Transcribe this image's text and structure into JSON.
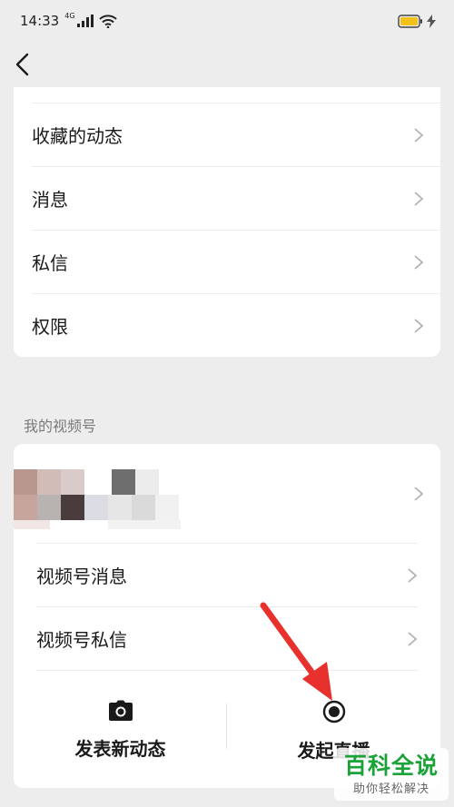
{
  "status_bar": {
    "time": "14:33",
    "network": "4G",
    "battery_color": "#f2c21b",
    "charging_color": "#555555"
  },
  "nav": {
    "back_icon": "chevron-left-icon"
  },
  "top_card": {
    "items": [
      {
        "label": "收藏的动态"
      },
      {
        "label": "消息"
      },
      {
        "label": "私信"
      },
      {
        "label": "权限"
      }
    ]
  },
  "video_section": {
    "header": "我的视频号",
    "items": [
      {
        "label": "视频号消息"
      },
      {
        "label": "视频号私信"
      }
    ],
    "actions": [
      {
        "label": "发表新动态",
        "icon": "camera-icon"
      },
      {
        "label": "发起直播",
        "icon": "live-record-icon"
      }
    ]
  },
  "annotation": {
    "arrow_color": "#e8302c"
  },
  "watermark": {
    "main": "百科全说",
    "sub": "助你轻松解决"
  }
}
